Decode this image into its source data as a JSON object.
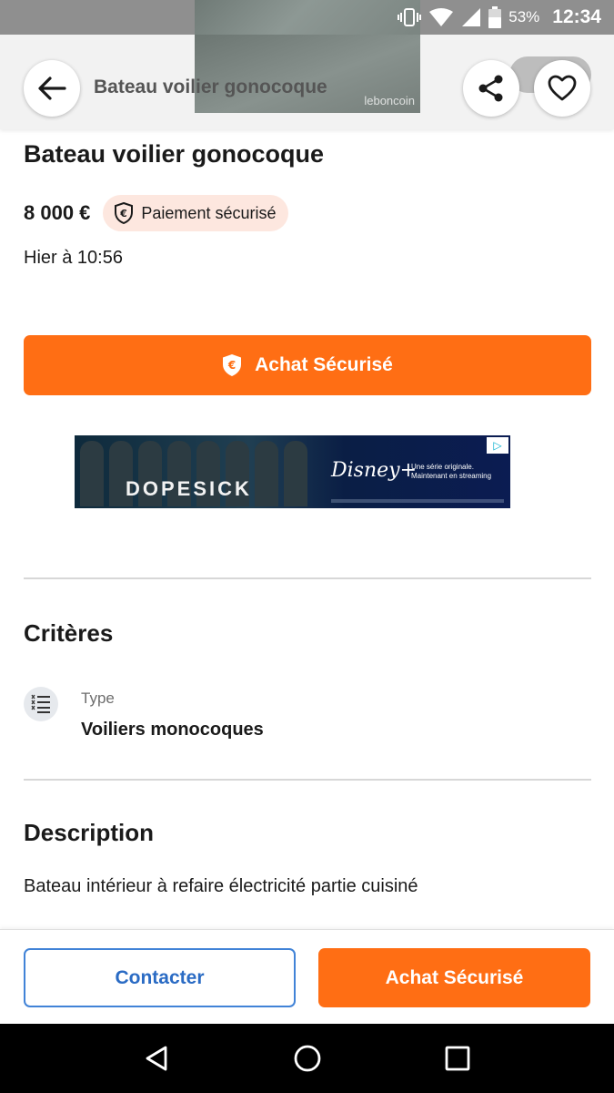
{
  "status_bar": {
    "battery_percent": "53%",
    "time": "12:34",
    "icons": [
      "vibrate-icon",
      "wifi-icon",
      "signal-icon",
      "battery-icon"
    ]
  },
  "header": {
    "title": "Bateau voilier gonocoque",
    "photo_watermark": "leboncoin",
    "icons": [
      "back-arrow-icon",
      "share-icon",
      "heart-icon"
    ]
  },
  "listing": {
    "title": "Bateau voilier gonocoque",
    "price": "8 000 €",
    "secure_payment_label": "Paiement sécurisé",
    "posted": "Hier à 10:56"
  },
  "buttons": {
    "secure_purchase": "Achat Sécurisé",
    "contact": "Contacter",
    "secure_purchase_bottom": "Achat Sécurisé"
  },
  "ad": {
    "show_title": "DOPESICK",
    "brand": "Disney+",
    "tagline_line1": "Une série originale.",
    "tagline_line2": "Maintenant en streaming",
    "choice_icon": "adchoices-icon"
  },
  "criteria": {
    "heading": "Critères",
    "items": [
      {
        "label": "Type",
        "value": "Voiliers monocoques",
        "icon": "list-icon"
      }
    ]
  },
  "description": {
    "heading": "Description",
    "text": "Bateau intérieur à refaire électricité partie cuisiné"
  },
  "colors": {
    "accent_orange": "#ff6e14",
    "contact_blue": "#4183d7",
    "badge_bg": "#fde7df"
  }
}
